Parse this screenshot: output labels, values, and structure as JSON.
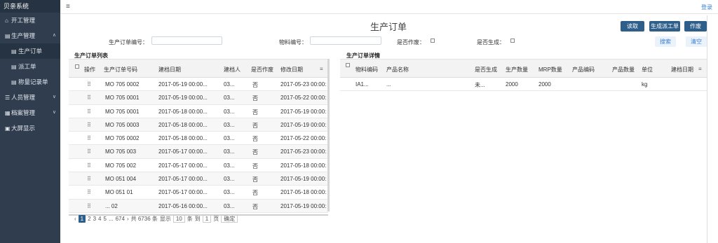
{
  "sidebar": {
    "brand": "贝亲系统",
    "items": [
      {
        "icon": "home-icon",
        "glyph": "⌂",
        "label": "开工管理"
      },
      {
        "icon": "document-icon",
        "glyph": "▤",
        "label": "生产管理",
        "chevron": "∧"
      },
      {
        "icon": "document-icon",
        "glyph": "▤",
        "label": "生产订单",
        "sub": true
      },
      {
        "icon": "document-icon",
        "glyph": "▤",
        "label": "派工单",
        "sub": true
      },
      {
        "icon": "document-icon",
        "glyph": "▤",
        "label": "称量记录单",
        "sub": true
      },
      {
        "icon": "users-icon",
        "glyph": "☰",
        "label": "人员管理",
        "chevron": "∨"
      },
      {
        "icon": "archive-icon",
        "glyph": "▦",
        "label": "档案管理",
        "chevron": "∨"
      },
      {
        "icon": "monitor-icon",
        "glyph": "▣",
        "label": "大屏显示"
      }
    ]
  },
  "topbar": {
    "menu_icon": "≡",
    "login": "登录"
  },
  "page": {
    "title": "生产订单",
    "buttons": {
      "read": "读取",
      "generate": "生成派工单",
      "void": "作废",
      "search": "搜索",
      "clear": "清空"
    }
  },
  "filters": {
    "order_no": "生产订单编号：",
    "material_no": "物料编号：",
    "voided": "是否作废：",
    "generated": "是否生成："
  },
  "left": {
    "title": "生产订单列表",
    "columns": [
      "操作",
      "生产订单号码",
      "建档日期",
      "建档人",
      "是否作废",
      "修改日期"
    ],
    "rows": [
      {
        "op": "⠿",
        "no": "MO 705 0002",
        "created": "2017-05-19 00:00...",
        "by": "03...",
        "voided": "否",
        "modified": "2017-05-23 00:00:"
      },
      {
        "op": "⠿",
        "no": "MO 705 0001",
        "created": "2017-05-19 00:00...",
        "by": "03...",
        "voided": "否",
        "modified": "2017-05-22 00:00:"
      },
      {
        "op": "⠿",
        "no": "MO 705 0001",
        "created": "2017-05-18 00:00...",
        "by": "03...",
        "voided": "否",
        "modified": "2017-05-19 00:00:"
      },
      {
        "op": "⠿",
        "no": "MO 705 0003",
        "created": "2017-05-18 00:00...",
        "by": "03...",
        "voided": "否",
        "modified": "2017-05-19 00:00:"
      },
      {
        "op": "⠿",
        "no": "MO 705 0002",
        "created": "2017-05-18 00:00...",
        "by": "03...",
        "voided": "否",
        "modified": "2017-05-22 00:00:"
      },
      {
        "op": "⠿",
        "no": "MO 705 003",
        "created": "2017-05-17 00:00...",
        "by": "03...",
        "voided": "否",
        "modified": "2017-05-23 00:00:"
      },
      {
        "op": "⠿",
        "no": "MO 705 002",
        "created": "2017-05-17 00:00...",
        "by": "03...",
        "voided": "否",
        "modified": "2017-05-18 00:00:"
      },
      {
        "op": "⠿",
        "no": "MO 051 004",
        "created": "2017-05-17 00:00...",
        "by": "03...",
        "voided": "否",
        "modified": "2017-05-19 00:00:"
      },
      {
        "op": "⠿",
        "no": "MO 051 01",
        "created": "2017-05-17 00:00...",
        "by": "03...",
        "voided": "否",
        "modified": "2017-05-18 00:00:"
      },
      {
        "op": "⠿",
        "no": "... 02",
        "created": "2017-05-16 00:00...",
        "by": "03...",
        "voided": "否",
        "modified": "2017-05-19 00:00:"
      }
    ]
  },
  "right": {
    "title": "生产订单详情",
    "columns": [
      "物料编码",
      "产品名称",
      "是否生成",
      "生产数量",
      "MRP数量",
      "产品编码",
      "产品数量",
      "单位",
      "建档日期"
    ],
    "rows": [
      {
        "material": "IA1...",
        "name": "...",
        "generated": "未...",
        "qty": "2000",
        "mrp": "2000",
        "code": "",
        "pqty": "",
        "unit": "kg",
        "created": ""
      }
    ]
  },
  "pager": {
    "prev": "‹",
    "pages": [
      "1",
      "2",
      "3",
      "4",
      "5",
      "...",
      "674"
    ],
    "next": "›",
    "total": "共 6736 条",
    "show": "显示",
    "per_page": "10",
    "per_unit": "条",
    "goto": "到",
    "page_value": "1",
    "page_unit": "页",
    "confirm": "确定"
  }
}
